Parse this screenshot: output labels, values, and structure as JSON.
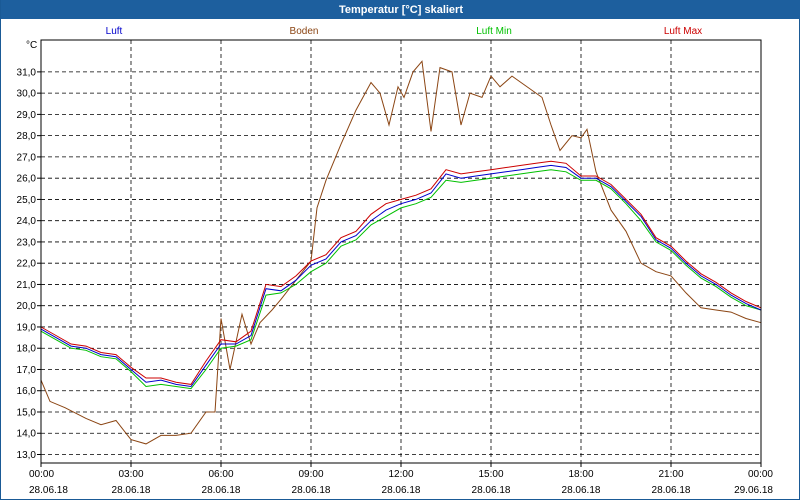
{
  "window": {
    "title": "Temperatur [°C] skaliert"
  },
  "chart_data": {
    "type": "line",
    "ylabel": "°C",
    "ylim": [
      12.6,
      32.5
    ],
    "yticks": [
      "13,0",
      "14,0",
      "15,0",
      "16,0",
      "17,0",
      "18,0",
      "19,0",
      "20,0",
      "21,0",
      "22,0",
      "23,0",
      "24,0",
      "25,0",
      "26,0",
      "27,0",
      "28,0",
      "29,0",
      "30,0",
      "31,0"
    ],
    "xticks": [
      {
        "time": "00:00",
        "date": "28.06.18"
      },
      {
        "time": "03:00",
        "date": "28.06.18"
      },
      {
        "time": "06:00",
        "date": "28.06.18"
      },
      {
        "time": "09:00",
        "date": "28.06.18"
      },
      {
        "time": "12:00",
        "date": "28.06.18"
      },
      {
        "time": "15:00",
        "date": "28.06.18"
      },
      {
        "time": "18:00",
        "date": "28.06.18"
      },
      {
        "time": "21:00",
        "date": "28.06.18"
      },
      {
        "time": "00:00",
        "date": "29.06.18"
      }
    ],
    "x_unit": "hours",
    "xlim": [
      0,
      24
    ],
    "grid": true,
    "legend_position": "top",
    "series": [
      {
        "name": "Luft",
        "color": "#0000cc",
        "x": [
          0,
          0.5,
          1,
          1.5,
          2,
          2.5,
          3,
          3.5,
          4,
          4.5,
          5,
          5.5,
          6,
          6.5,
          7,
          7.5,
          8,
          8.5,
          9,
          9.5,
          10,
          10.5,
          11,
          11.5,
          12,
          12.5,
          13,
          13.5,
          14,
          14.5,
          15,
          15.5,
          16,
          16.5,
          17,
          17.5,
          18,
          18.5,
          19,
          19.5,
          20,
          20.5,
          21,
          21.5,
          22,
          22.5,
          23,
          23.5,
          24
        ],
        "y": [
          18.9,
          18.5,
          18.1,
          18.0,
          17.7,
          17.6,
          17.0,
          16.4,
          16.5,
          16.3,
          16.2,
          17.2,
          18.2,
          18.2,
          18.6,
          20.8,
          20.7,
          21.2,
          21.9,
          22.2,
          23.0,
          23.3,
          24.0,
          24.5,
          24.8,
          25.0,
          25.3,
          26.2,
          26.0,
          26.1,
          26.2,
          26.3,
          26.4,
          26.5,
          26.6,
          26.5,
          26.0,
          26.0,
          25.6,
          24.9,
          24.2,
          23.1,
          22.7,
          22.0,
          21.4,
          21.0,
          20.5,
          20.1,
          19.8
        ]
      },
      {
        "name": "Boden",
        "color": "#8b4513",
        "x": [
          0,
          0.3,
          0.8,
          1.5,
          2,
          2.5,
          3,
          3.5,
          4,
          4.5,
          5,
          5.5,
          5.8,
          6,
          6.3,
          6.7,
          7,
          7.3,
          7.7,
          8,
          8.5,
          9,
          9.2,
          9.5,
          10,
          10.5,
          11,
          11.3,
          11.6,
          11.9,
          12.1,
          12.4,
          12.7,
          13,
          13.3,
          13.7,
          14,
          14.3,
          14.7,
          15,
          15.3,
          15.7,
          16,
          16.3,
          16.7,
          17,
          17.3,
          17.7,
          18,
          18.2,
          18.5,
          19,
          19.5,
          20,
          20.5,
          21,
          21.5,
          22,
          22.5,
          23,
          23.5,
          24
        ],
        "y": [
          16.5,
          15.5,
          15.2,
          14.7,
          14.4,
          14.6,
          13.7,
          13.5,
          13.9,
          13.9,
          14.0,
          15.0,
          15.0,
          19.4,
          17.0,
          19.6,
          18.2,
          19.2,
          19.8,
          20.3,
          21.2,
          22.1,
          24.6,
          25.9,
          27.6,
          29.2,
          30.5,
          30.0,
          28.5,
          30.3,
          29.8,
          31.0,
          31.5,
          28.2,
          31.2,
          31.0,
          28.5,
          30.0,
          29.8,
          30.8,
          30.3,
          30.8,
          30.5,
          30.2,
          29.8,
          28.5,
          27.3,
          28.0,
          27.9,
          28.3,
          26.3,
          24.5,
          23.5,
          22.0,
          21.6,
          21.4,
          20.6,
          19.9,
          19.8,
          19.7,
          19.4,
          19.2
        ]
      },
      {
        "name": "Luft Min",
        "color": "#00c000",
        "x": [
          0,
          0.5,
          1,
          1.5,
          2,
          2.5,
          3,
          3.5,
          4,
          4.5,
          5,
          5.5,
          6,
          6.5,
          7,
          7.5,
          8,
          8.5,
          9,
          9.5,
          10,
          10.5,
          11,
          11.5,
          12,
          12.5,
          13,
          13.5,
          14,
          14.5,
          15,
          15.5,
          16,
          16.5,
          17,
          17.5,
          18,
          18.5,
          19,
          19.5,
          20,
          20.5,
          21,
          21.5,
          22,
          22.5,
          23,
          23.5,
          24
        ],
        "y": [
          18.8,
          18.4,
          18.0,
          17.9,
          17.6,
          17.5,
          16.9,
          16.2,
          16.3,
          16.2,
          16.1,
          17.0,
          18.0,
          18.1,
          18.4,
          20.5,
          20.6,
          21.0,
          21.6,
          22.0,
          22.8,
          23.1,
          23.8,
          24.2,
          24.6,
          24.8,
          25.1,
          25.9,
          25.8,
          25.9,
          26.0,
          26.1,
          26.2,
          26.3,
          26.4,
          26.3,
          25.9,
          25.9,
          25.5,
          24.8,
          24.0,
          23.0,
          22.6,
          21.9,
          21.3,
          20.9,
          20.4,
          20.0,
          19.8
        ]
      },
      {
        "name": "Luft Max",
        "color": "#cc0000",
        "x": [
          0,
          0.5,
          1,
          1.5,
          2,
          2.5,
          3,
          3.5,
          4,
          4.5,
          5,
          5.5,
          6,
          6.5,
          7,
          7.5,
          8,
          8.5,
          9,
          9.5,
          10,
          10.5,
          11,
          11.5,
          12,
          12.5,
          13,
          13.5,
          14,
          14.5,
          15,
          15.5,
          16,
          16.5,
          17,
          17.5,
          18,
          18.5,
          19,
          19.5,
          20,
          20.5,
          21,
          21.5,
          22,
          22.5,
          23,
          23.5,
          24
        ],
        "y": [
          19.0,
          18.6,
          18.2,
          18.1,
          17.8,
          17.7,
          17.1,
          16.6,
          16.6,
          16.4,
          16.3,
          17.4,
          18.4,
          18.3,
          18.8,
          21.0,
          20.9,
          21.4,
          22.1,
          22.4,
          23.2,
          23.5,
          24.3,
          24.8,
          25.0,
          25.2,
          25.5,
          26.4,
          26.2,
          26.3,
          26.4,
          26.5,
          26.6,
          26.7,
          26.8,
          26.7,
          26.1,
          26.1,
          25.7,
          25.0,
          24.3,
          23.2,
          22.8,
          22.1,
          21.5,
          21.1,
          20.6,
          20.2,
          19.9
        ]
      }
    ]
  }
}
